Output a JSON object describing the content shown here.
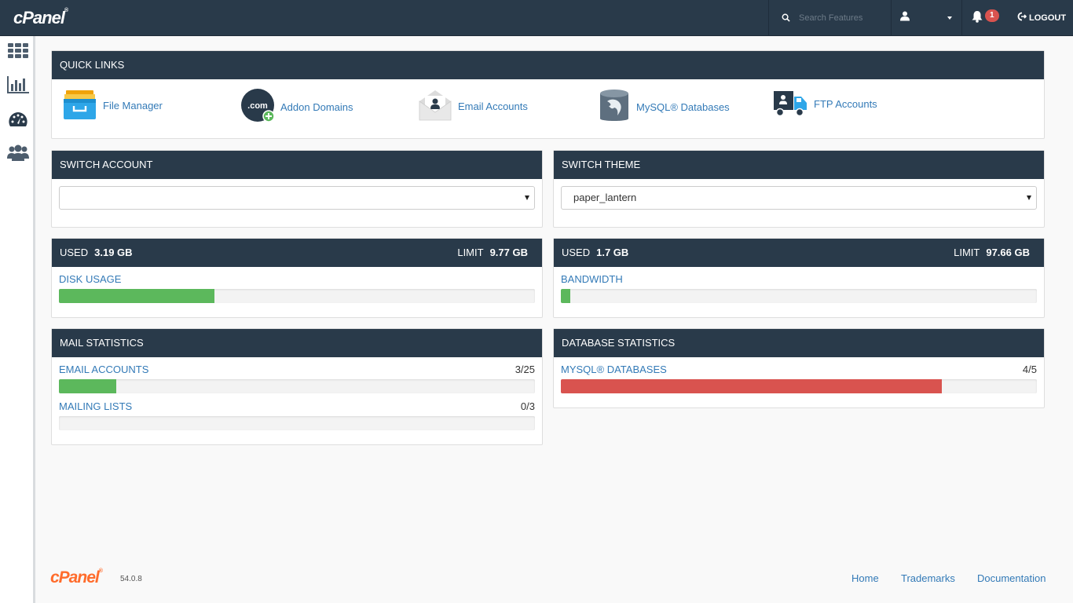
{
  "header": {
    "logo": "cPanel",
    "search_placeholder": "Search Features",
    "notifications": "1",
    "logout": "LOGOUT"
  },
  "sidebar": {
    "icons": [
      "grid-icon",
      "chart-icon",
      "dashboard-icon",
      "users-icon"
    ]
  },
  "quick_links": {
    "title": "QUICK LINKS",
    "items": [
      {
        "label": "File Manager",
        "icon": "file-manager-icon"
      },
      {
        "label": "Addon Domains",
        "icon": "addon-domains-icon"
      },
      {
        "label": "Email Accounts",
        "icon": "email-accounts-icon"
      },
      {
        "label": "MySQL® Databases",
        "icon": "mysql-databases-icon"
      },
      {
        "label": "FTP Accounts",
        "icon": "ftp-accounts-icon"
      }
    ],
    "dotcom": ".com"
  },
  "switch_account": {
    "title": "SWITCH ACCOUNT",
    "value": ""
  },
  "switch_theme": {
    "title": "SWITCH THEME",
    "value": "paper_lantern"
  },
  "disk": {
    "used_label": "USED",
    "used": "3.19 GB",
    "limit_label": "LIMIT",
    "limit": "9.77 GB",
    "label": "DISK USAGE",
    "percent": 32.7
  },
  "bandwidth": {
    "used_label": "USED",
    "used": "1.7 GB",
    "limit_label": "LIMIT",
    "limit": "97.66 GB",
    "label": "BANDWIDTH",
    "percent": 1.9
  },
  "mail_stats": {
    "title": "MAIL STATISTICS",
    "rows": [
      {
        "label": "EMAIL ACCOUNTS",
        "count": "3/25",
        "percent": 12
      },
      {
        "label": "MAILING LISTS",
        "count": "0/3",
        "percent": 0
      }
    ]
  },
  "db_stats": {
    "title": "DATABASE STATISTICS",
    "rows": [
      {
        "label": "MYSQL® DATABASES",
        "count": "4/5",
        "percent": 80
      }
    ]
  },
  "colors": {
    "ok": "#5cb85c",
    "danger": "#d9534f",
    "header": "#293a4a",
    "link": "#337ab7"
  },
  "footer": {
    "logo": "cPanel",
    "version": "54.0.8",
    "links": [
      "Home",
      "Trademarks",
      "Documentation"
    ]
  }
}
